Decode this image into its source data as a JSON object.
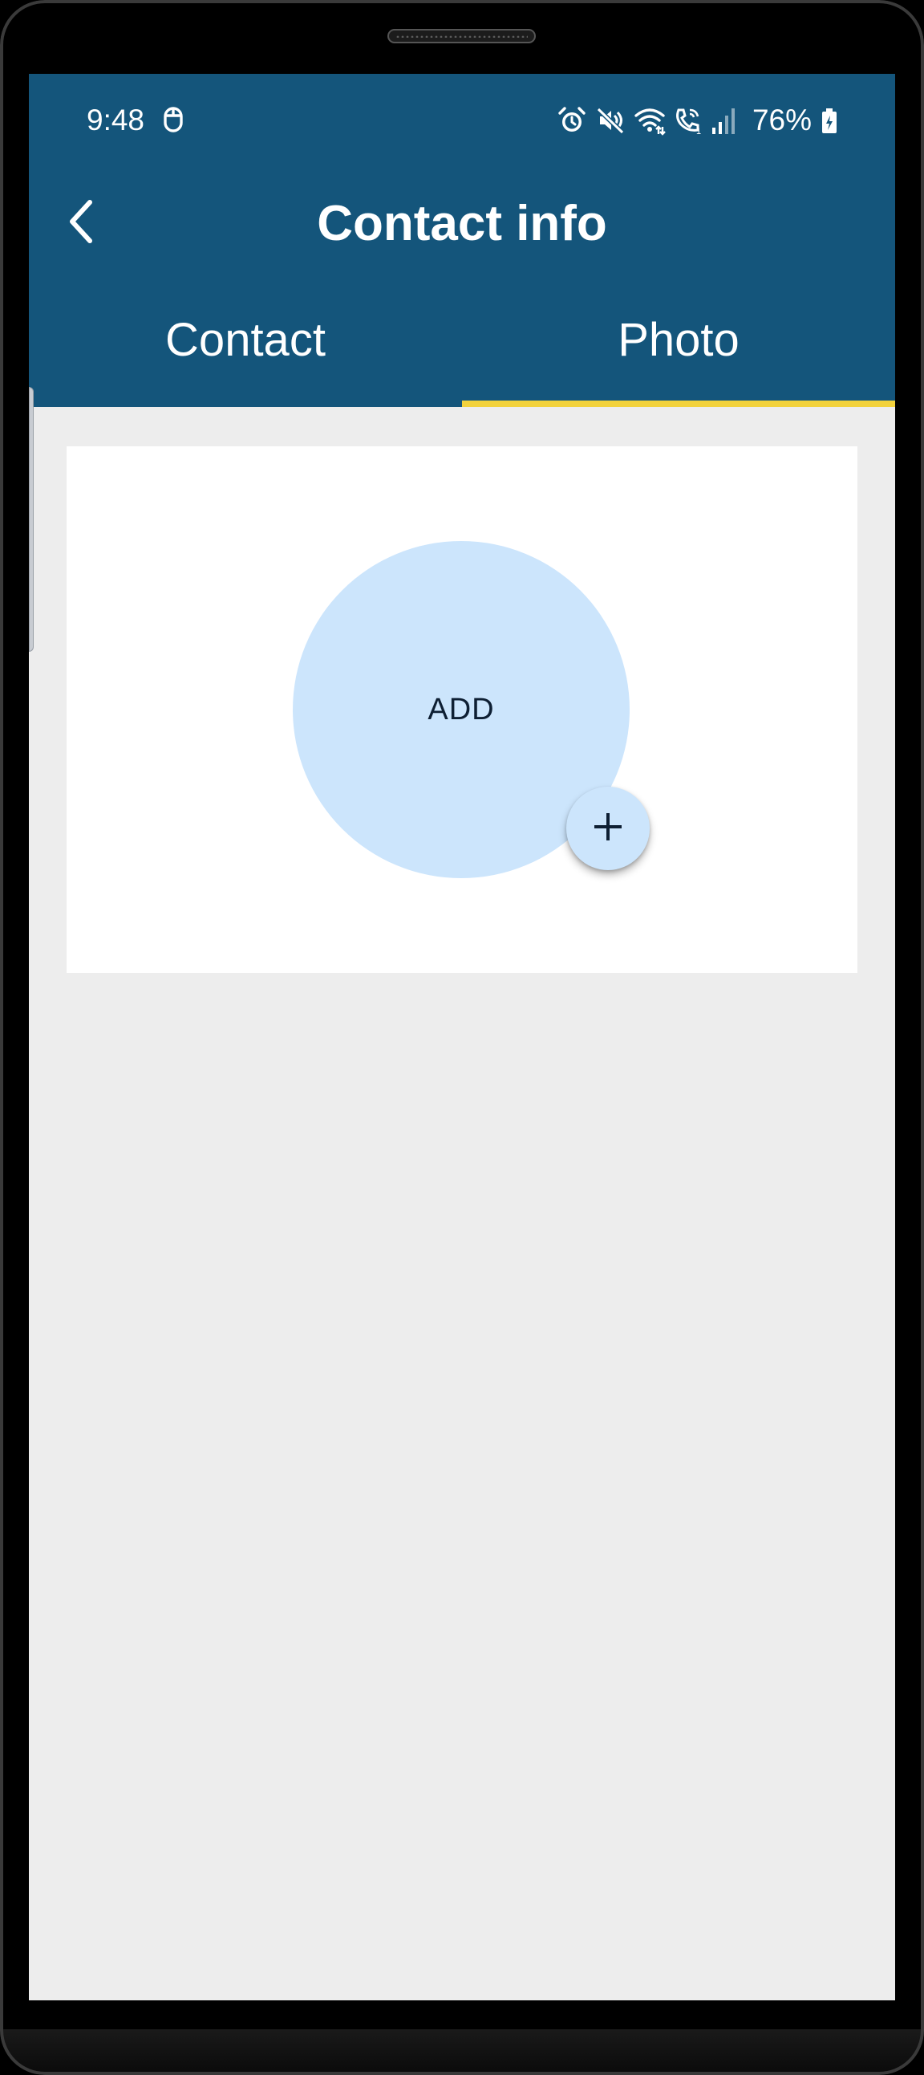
{
  "status_bar": {
    "time": "9:48",
    "battery_percent": "76%",
    "icons": [
      "notification-icon",
      "alarm-icon",
      "mute-icon",
      "wifi-icon",
      "wifi-calling-icon",
      "signal-icon",
      "battery-charging-icon"
    ]
  },
  "toolbar": {
    "title": "Contact info",
    "back_icon": "chevron-left-icon"
  },
  "tabs": [
    {
      "label": "Contact",
      "selected": false
    },
    {
      "label": "Photo",
      "selected": true
    }
  ],
  "photo": {
    "add_label": "ADD",
    "fab_icon": "plus-icon"
  },
  "colors": {
    "header": "#14557b",
    "tab_indicator": "#f2d23c",
    "background": "#ededed",
    "card": "#ffffff",
    "avatar": "#cce5fc",
    "avatar_text": "#0e1f33"
  }
}
